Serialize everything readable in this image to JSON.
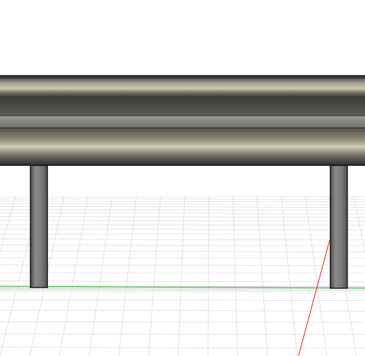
{
  "viewport": {
    "background_color": "#ffffff",
    "grid_color": "#d6d6d6",
    "grid_line_count_minor": 30,
    "x_axis_color": "#3cc43c",
    "y_axis_color": "#e02020"
  },
  "model": {
    "name": "guardrail",
    "beam_color_dark": "#4b4944",
    "beam_color_light": "#c6bfa8",
    "post_color": "#6e6e6e",
    "outline_color": "#1a1a1a",
    "post_count": 2
  }
}
